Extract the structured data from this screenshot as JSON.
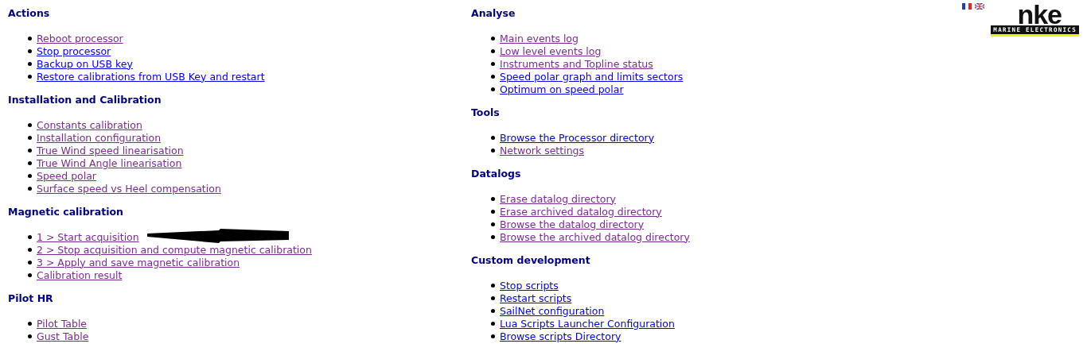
{
  "logo": {
    "brand": "nke",
    "tagline": "MARINE ELECTRONICS"
  },
  "columns": [
    {
      "sections": [
        {
          "title": "Actions",
          "links": [
            {
              "label": "Reboot processor",
              "visited": true
            },
            {
              "label": "Stop processor",
              "visited": false
            },
            {
              "label": "Backup on USB key",
              "visited": false
            },
            {
              "label": "Restore calibrations from USB Key and restart",
              "visited": false
            }
          ]
        },
        {
          "title": "Installation and Calibration",
          "links": [
            {
              "label": "Constants calibration",
              "visited": true
            },
            {
              "label": "Installation configuration",
              "visited": true
            },
            {
              "label": "True Wind speed linearisation",
              "visited": true
            },
            {
              "label": "True Wind Angle linearisation",
              "visited": true
            },
            {
              "label": "Speed polar",
              "visited": true
            },
            {
              "label": "Surface speed vs Heel compensation",
              "visited": true
            }
          ]
        },
        {
          "title": "Magnetic calibration",
          "links": [
            {
              "label": "1 > Start acquisition",
              "visited": true,
              "arrow": true
            },
            {
              "label": "2 > Stop acquisition and compute magnetic calibration",
              "visited": true
            },
            {
              "label": "3 > Apply and save magnetic calibration",
              "visited": true
            },
            {
              "label": "Calibration result",
              "visited": true
            }
          ]
        },
        {
          "title": "Pilot HR",
          "links": [
            {
              "label": "Pilot Table",
              "visited": true
            },
            {
              "label": "Gust Table",
              "visited": true
            }
          ]
        }
      ]
    },
    {
      "sections": [
        {
          "title": "Analyse",
          "links": [
            {
              "label": "Main events log",
              "visited": true
            },
            {
              "label": "Low level events log",
              "visited": true
            },
            {
              "label": "Instruments and Topline status",
              "visited": true
            },
            {
              "label": "Speed polar graph and limits sectors",
              "visited": false
            },
            {
              "label": "Optimum on speed polar",
              "visited": false
            }
          ]
        },
        {
          "title": "Tools",
          "links": [
            {
              "label": "Browse the Processor directory",
              "visited": false
            },
            {
              "label": "Network settings",
              "visited": true
            }
          ]
        },
        {
          "title": "Datalogs",
          "links": [
            {
              "label": "Erase datalog directory",
              "visited": true
            },
            {
              "label": "Erase archived datalog directory",
              "visited": true
            },
            {
              "label": "Browse the datalog directory",
              "visited": true
            },
            {
              "label": "Browse the archived datalog directory",
              "visited": true
            }
          ]
        },
        {
          "title": "Custom development",
          "links": [
            {
              "label": "Stop scripts",
              "visited": false
            },
            {
              "label": "Restart scripts",
              "visited": false
            },
            {
              "label": "SailNet configuration",
              "visited": false
            },
            {
              "label": "Lua Scripts Launcher Configuration",
              "visited": false
            },
            {
              "label": "Browse scripts Directory",
              "visited": false
            }
          ]
        }
      ]
    }
  ]
}
